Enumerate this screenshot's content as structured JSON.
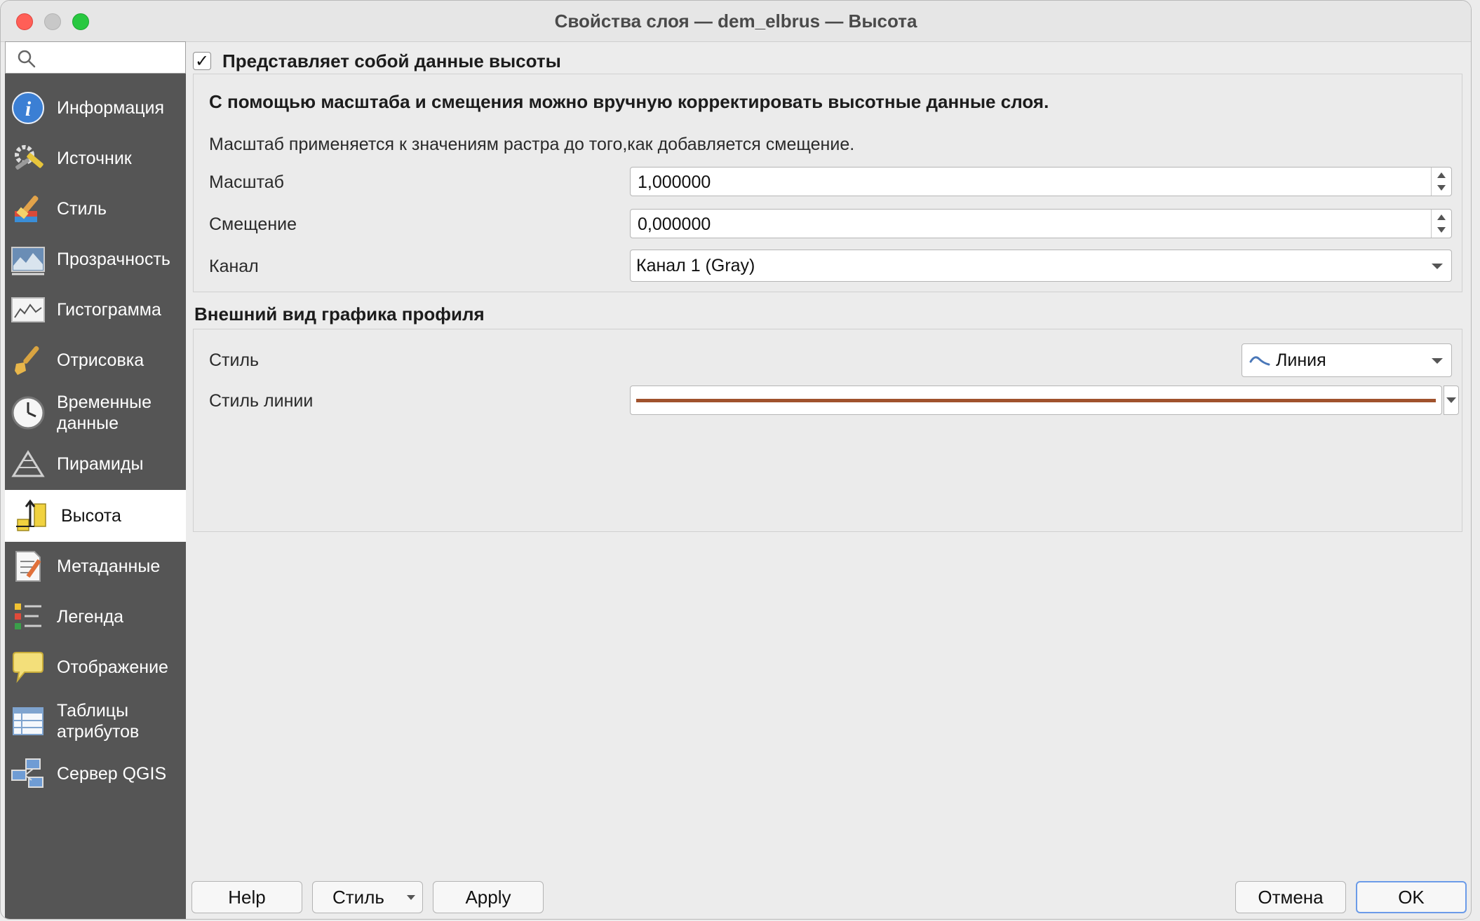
{
  "window": {
    "title": "Свойства слоя — dem_elbrus — Высота"
  },
  "sidebar": {
    "search_placeholder": "",
    "items": [
      {
        "label": "Информация",
        "icon": "info-icon"
      },
      {
        "label": "Источник",
        "icon": "source-tools-icon"
      },
      {
        "label": "Стиль",
        "icon": "style-brush-icon"
      },
      {
        "label": "Прозрачность",
        "icon": "transparency-icon"
      },
      {
        "label": "Гистограмма",
        "icon": "histogram-icon"
      },
      {
        "label": "Отрисовка",
        "icon": "rendering-brush-icon"
      },
      {
        "label": "Временные данные",
        "icon": "clock-icon"
      },
      {
        "label": "Пирамиды",
        "icon": "pyramids-icon"
      },
      {
        "label": "Высота",
        "icon": "elevation-icon",
        "active": true
      },
      {
        "label": "Метаданные",
        "icon": "metadata-icon"
      },
      {
        "label": "Легенда",
        "icon": "legend-icon"
      },
      {
        "label": "Отображение",
        "icon": "display-speech-icon"
      },
      {
        "label": "Таблицы атрибутов",
        "icon": "attribute-table-icon"
      },
      {
        "label": "Сервер QGIS",
        "icon": "qgis-server-icon"
      }
    ]
  },
  "elevation": {
    "checkbox_label": "Представляет собой данные высоты",
    "checked": true,
    "group_title": "С помощью масштаба и смещения можно вручную корректировать высотные данные слоя.",
    "note": "Масштаб применяется к значениям растра до того,как добавляется смещение.",
    "scale_label": "Масштаб",
    "scale_value": "1,000000",
    "offset_label": "Смещение",
    "offset_value": "0,000000",
    "band_label": "Канал",
    "band_value": "Канал 1 (Gray)"
  },
  "profile": {
    "heading": "Внешний вид графика профиля",
    "style_label": "Стиль",
    "style_value": "Линия",
    "line_style_label": "Стиль линии",
    "line_color": "#a0522d"
  },
  "buttons": {
    "help": "Help",
    "style": "Стиль",
    "apply": "Apply",
    "cancel": "Отмена",
    "ok": "OK"
  }
}
